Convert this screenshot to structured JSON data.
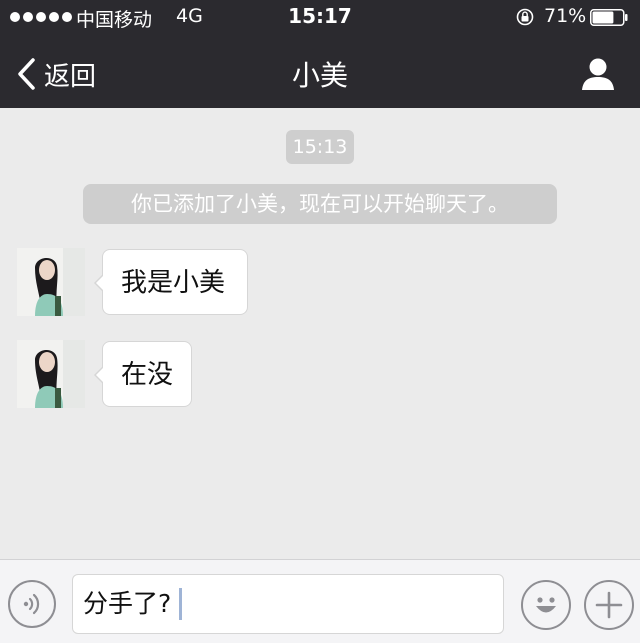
{
  "status_bar": {
    "carrier": "中国移动",
    "network": "4G",
    "time": "15:17",
    "battery_percent": "71%",
    "battery_level": 0.71,
    "icons": [
      "signal-dots-icon",
      "rotation-lock-icon",
      "battery-icon"
    ]
  },
  "nav_bar": {
    "back_label": "返回",
    "title": "小美",
    "icons": [
      "chevron-left-icon",
      "profile-icon"
    ]
  },
  "chat": {
    "timestamp": "15:13",
    "system_message": "你已添加了小美，现在可以开始聊天了。",
    "messages": [
      {
        "sender": "小美",
        "text": "我是小美"
      },
      {
        "sender": "小美",
        "text": "在没"
      }
    ]
  },
  "input_bar": {
    "value": "分手了?",
    "icons": [
      "voice-icon",
      "emoji-icon",
      "plus-icon"
    ]
  },
  "colors": {
    "header_bg": "#2b2a2f",
    "chat_bg": "#ebebeb",
    "system_pill": "#cecece",
    "bubble_bg": "#ffffff",
    "caret": "#9fb4d6"
  }
}
